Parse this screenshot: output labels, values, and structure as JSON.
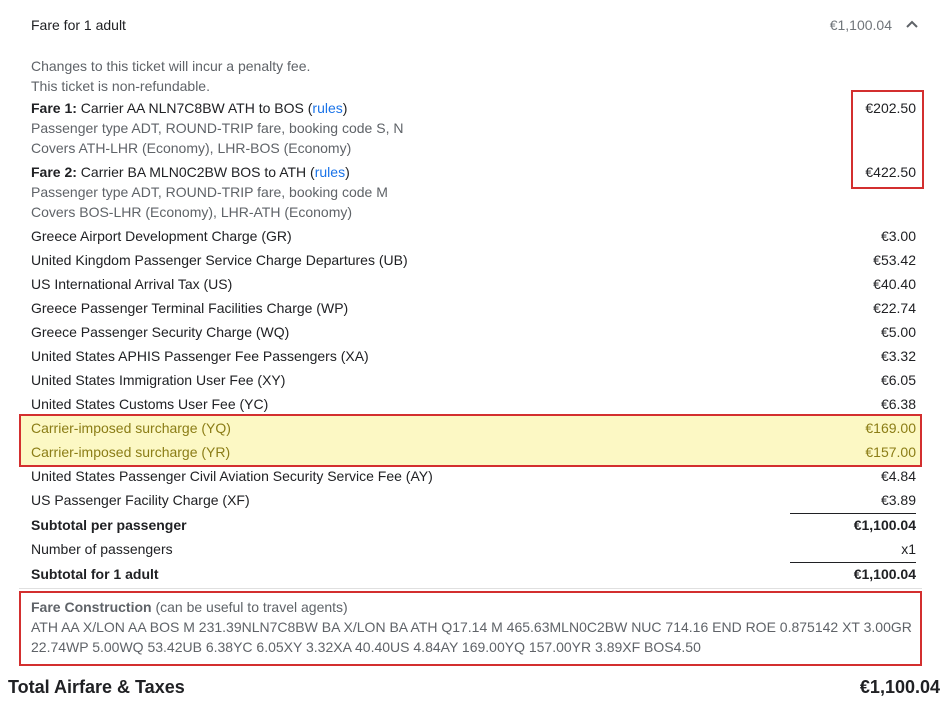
{
  "header": {
    "title": "Fare for 1 adult",
    "price": "€1,100.04"
  },
  "notes": [
    "Changes to this ticket will incur a penalty fee.",
    "This ticket is non-refundable."
  ],
  "fares": [
    {
      "label": "Fare 1:",
      "desc": " Carrier AA NLN7C8BW ATH to BOS (",
      "link": "rules",
      "close": ")",
      "amount": "€202.50",
      "sub1": "Passenger type ADT, ROUND-TRIP fare, booking code S, N",
      "sub2": "Covers ATH-LHR (Economy), LHR-BOS (Economy)"
    },
    {
      "label": "Fare 2:",
      "desc": " Carrier BA MLN0C2BW BOS to ATH (",
      "link": "rules",
      "close": ")",
      "amount": "€422.50",
      "sub1": "Passenger type ADT, ROUND-TRIP fare, booking code M",
      "sub2": "Covers BOS-LHR (Economy), LHR-ATH (Economy)"
    }
  ],
  "taxes": [
    {
      "label": "Greece Airport Development Charge (GR)",
      "amount": "€3.00"
    },
    {
      "label": "United Kingdom Passenger Service Charge Departures (UB)",
      "amount": "€53.42"
    },
    {
      "label": "US International Arrival Tax (US)",
      "amount": "€40.40"
    },
    {
      "label": "Greece Passenger Terminal Facilities Charge (WP)",
      "amount": "€22.74"
    },
    {
      "label": "Greece Passenger Security Charge (WQ)",
      "amount": "€5.00"
    },
    {
      "label": "United States APHIS Passenger Fee Passengers (XA)",
      "amount": "€3.32"
    },
    {
      "label": "United States Immigration User Fee (XY)",
      "amount": "€6.05"
    },
    {
      "label": "United States Customs User Fee (YC)",
      "amount": "€6.38"
    },
    {
      "label": "Carrier-imposed surcharge (YQ)",
      "amount": "€169.00"
    },
    {
      "label": "Carrier-imposed surcharge (YR)",
      "amount": "€157.00"
    },
    {
      "label": "United States Passenger Civil Aviation Security Service Fee (AY)",
      "amount": "€4.84"
    },
    {
      "label": "US Passenger Facility Charge (XF)",
      "amount": "€3.89"
    }
  ],
  "subtotal_per_passenger": {
    "label": "Subtotal per passenger",
    "amount": "€1,100.04"
  },
  "passengers": {
    "label": "Number of passengers",
    "amount": "x1"
  },
  "subtotal_adult": {
    "label": "Subtotal for 1 adult",
    "amount": "€1,100.04"
  },
  "fare_construction": {
    "title": "Fare Construction",
    "hint": " (can be useful to travel agents)",
    "text": "ATH AA X/LON AA BOS M 231.39NLN7C8BW BA X/LON BA ATH Q17.14 M 465.63MLN0C2BW NUC 714.16 END ROE 0.875142 XT 3.00GR 22.74WP 5.00WQ 53.42UB 6.38YC 6.05XY 3.32XA 40.40US 4.84AY 169.00YQ 157.00YR 3.89XF BOS4.50"
  },
  "total": {
    "label": "Total Airfare & Taxes",
    "amount": "€1,100.04"
  },
  "colors": {
    "highlight_bg": "#fcf8c4",
    "highlight_text": "#8b7d16",
    "annotation_box": "#d32f2f",
    "link": "#1a73e8"
  },
  "icons": {
    "collapse": "chevron-up-icon"
  }
}
